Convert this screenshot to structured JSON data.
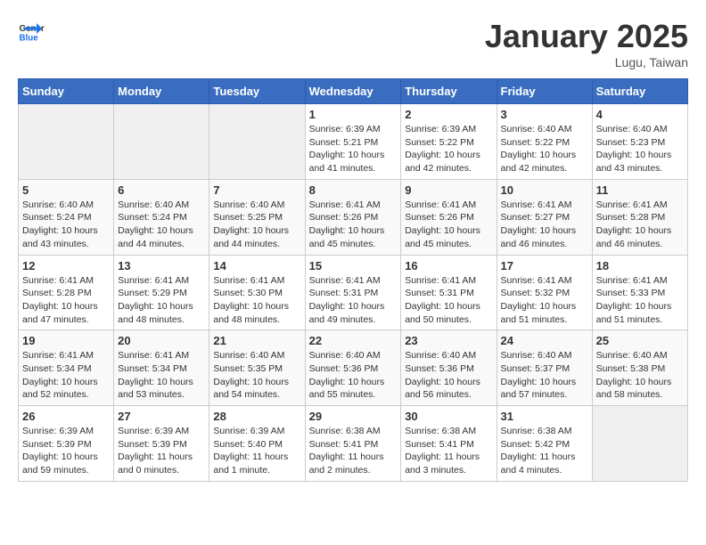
{
  "header": {
    "logo": {
      "general": "General",
      "blue": "Blue"
    },
    "title": "January 2025",
    "subtitle": "Lugu, Taiwan"
  },
  "weekdays": [
    "Sunday",
    "Monday",
    "Tuesday",
    "Wednesday",
    "Thursday",
    "Friday",
    "Saturday"
  ],
  "weeks": [
    [
      {
        "day": null
      },
      {
        "day": null
      },
      {
        "day": null
      },
      {
        "day": "1",
        "sunrise": "Sunrise: 6:39 AM",
        "sunset": "Sunset: 5:21 PM",
        "daylight": "Daylight: 10 hours and 41 minutes."
      },
      {
        "day": "2",
        "sunrise": "Sunrise: 6:39 AM",
        "sunset": "Sunset: 5:22 PM",
        "daylight": "Daylight: 10 hours and 42 minutes."
      },
      {
        "day": "3",
        "sunrise": "Sunrise: 6:40 AM",
        "sunset": "Sunset: 5:22 PM",
        "daylight": "Daylight: 10 hours and 42 minutes."
      },
      {
        "day": "4",
        "sunrise": "Sunrise: 6:40 AM",
        "sunset": "Sunset: 5:23 PM",
        "daylight": "Daylight: 10 hours and 43 minutes."
      }
    ],
    [
      {
        "day": "5",
        "sunrise": "Sunrise: 6:40 AM",
        "sunset": "Sunset: 5:24 PM",
        "daylight": "Daylight: 10 hours and 43 minutes."
      },
      {
        "day": "6",
        "sunrise": "Sunrise: 6:40 AM",
        "sunset": "Sunset: 5:24 PM",
        "daylight": "Daylight: 10 hours and 44 minutes."
      },
      {
        "day": "7",
        "sunrise": "Sunrise: 6:40 AM",
        "sunset": "Sunset: 5:25 PM",
        "daylight": "Daylight: 10 hours and 44 minutes."
      },
      {
        "day": "8",
        "sunrise": "Sunrise: 6:41 AM",
        "sunset": "Sunset: 5:26 PM",
        "daylight": "Daylight: 10 hours and 45 minutes."
      },
      {
        "day": "9",
        "sunrise": "Sunrise: 6:41 AM",
        "sunset": "Sunset: 5:26 PM",
        "daylight": "Daylight: 10 hours and 45 minutes."
      },
      {
        "day": "10",
        "sunrise": "Sunrise: 6:41 AM",
        "sunset": "Sunset: 5:27 PM",
        "daylight": "Daylight: 10 hours and 46 minutes."
      },
      {
        "day": "11",
        "sunrise": "Sunrise: 6:41 AM",
        "sunset": "Sunset: 5:28 PM",
        "daylight": "Daylight: 10 hours and 46 minutes."
      }
    ],
    [
      {
        "day": "12",
        "sunrise": "Sunrise: 6:41 AM",
        "sunset": "Sunset: 5:28 PM",
        "daylight": "Daylight: 10 hours and 47 minutes."
      },
      {
        "day": "13",
        "sunrise": "Sunrise: 6:41 AM",
        "sunset": "Sunset: 5:29 PM",
        "daylight": "Daylight: 10 hours and 48 minutes."
      },
      {
        "day": "14",
        "sunrise": "Sunrise: 6:41 AM",
        "sunset": "Sunset: 5:30 PM",
        "daylight": "Daylight: 10 hours and 48 minutes."
      },
      {
        "day": "15",
        "sunrise": "Sunrise: 6:41 AM",
        "sunset": "Sunset: 5:31 PM",
        "daylight": "Daylight: 10 hours and 49 minutes."
      },
      {
        "day": "16",
        "sunrise": "Sunrise: 6:41 AM",
        "sunset": "Sunset: 5:31 PM",
        "daylight": "Daylight: 10 hours and 50 minutes."
      },
      {
        "day": "17",
        "sunrise": "Sunrise: 6:41 AM",
        "sunset": "Sunset: 5:32 PM",
        "daylight": "Daylight: 10 hours and 51 minutes."
      },
      {
        "day": "18",
        "sunrise": "Sunrise: 6:41 AM",
        "sunset": "Sunset: 5:33 PM",
        "daylight": "Daylight: 10 hours and 51 minutes."
      }
    ],
    [
      {
        "day": "19",
        "sunrise": "Sunrise: 6:41 AM",
        "sunset": "Sunset: 5:34 PM",
        "daylight": "Daylight: 10 hours and 52 minutes."
      },
      {
        "day": "20",
        "sunrise": "Sunrise: 6:41 AM",
        "sunset": "Sunset: 5:34 PM",
        "daylight": "Daylight: 10 hours and 53 minutes."
      },
      {
        "day": "21",
        "sunrise": "Sunrise: 6:40 AM",
        "sunset": "Sunset: 5:35 PM",
        "daylight": "Daylight: 10 hours and 54 minutes."
      },
      {
        "day": "22",
        "sunrise": "Sunrise: 6:40 AM",
        "sunset": "Sunset: 5:36 PM",
        "daylight": "Daylight: 10 hours and 55 minutes."
      },
      {
        "day": "23",
        "sunrise": "Sunrise: 6:40 AM",
        "sunset": "Sunset: 5:36 PM",
        "daylight": "Daylight: 10 hours and 56 minutes."
      },
      {
        "day": "24",
        "sunrise": "Sunrise: 6:40 AM",
        "sunset": "Sunset: 5:37 PM",
        "daylight": "Daylight: 10 hours and 57 minutes."
      },
      {
        "day": "25",
        "sunrise": "Sunrise: 6:40 AM",
        "sunset": "Sunset: 5:38 PM",
        "daylight": "Daylight: 10 hours and 58 minutes."
      }
    ],
    [
      {
        "day": "26",
        "sunrise": "Sunrise: 6:39 AM",
        "sunset": "Sunset: 5:39 PM",
        "daylight": "Daylight: 10 hours and 59 minutes."
      },
      {
        "day": "27",
        "sunrise": "Sunrise: 6:39 AM",
        "sunset": "Sunset: 5:39 PM",
        "daylight": "Daylight: 11 hours and 0 minutes."
      },
      {
        "day": "28",
        "sunrise": "Sunrise: 6:39 AM",
        "sunset": "Sunset: 5:40 PM",
        "daylight": "Daylight: 11 hours and 1 minute."
      },
      {
        "day": "29",
        "sunrise": "Sunrise: 6:38 AM",
        "sunset": "Sunset: 5:41 PM",
        "daylight": "Daylight: 11 hours and 2 minutes."
      },
      {
        "day": "30",
        "sunrise": "Sunrise: 6:38 AM",
        "sunset": "Sunset: 5:41 PM",
        "daylight": "Daylight: 11 hours and 3 minutes."
      },
      {
        "day": "31",
        "sunrise": "Sunrise: 6:38 AM",
        "sunset": "Sunset: 5:42 PM",
        "daylight": "Daylight: 11 hours and 4 minutes."
      },
      {
        "day": null
      }
    ]
  ]
}
